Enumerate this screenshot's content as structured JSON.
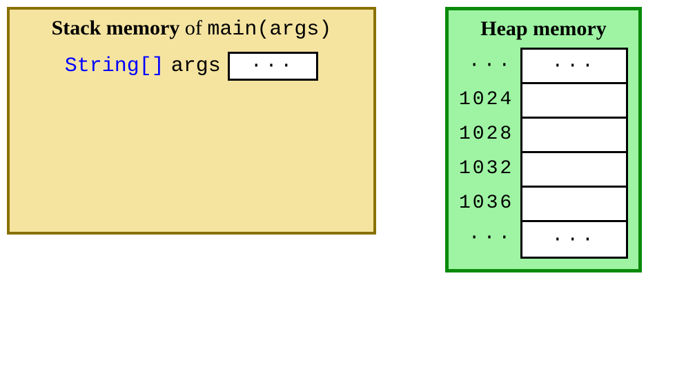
{
  "stack": {
    "title_bold": "Stack memory",
    "title_of": " of ",
    "title_mono": "main(args)",
    "var": {
      "type": "String[]",
      "name": "args",
      "value": "···"
    }
  },
  "heap": {
    "title": "Heap memory",
    "rows": [
      {
        "addr": "···",
        "value": "···"
      },
      {
        "addr": "1024",
        "value": ""
      },
      {
        "addr": "1028",
        "value": ""
      },
      {
        "addr": "1032",
        "value": ""
      },
      {
        "addr": "1036",
        "value": ""
      },
      {
        "addr": "···",
        "value": "···"
      }
    ]
  }
}
